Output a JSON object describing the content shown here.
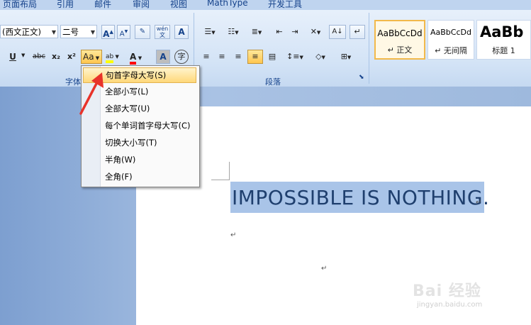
{
  "tabs": [
    "页面布局",
    "引用",
    "邮件",
    "审阅",
    "视图",
    "MathType",
    "开发工具"
  ],
  "font": {
    "family_value": "(西文正文)",
    "size_value": "二号",
    "group_label": "字体",
    "grow_glyph": "A",
    "shrink_glyph": "A",
    "wen_glyph": "wén",
    "underline_glyph": "U",
    "strike_glyph": "abc",
    "subscript_glyph": "x₂",
    "superscript_glyph": "x²",
    "case_glyph": "Aa",
    "highlight_glyph": "ab",
    "color_glyph": "A",
    "shade_glyph": "A",
    "enclose_glyph": "字",
    "highlight_color": "#ffff00",
    "font_color": "#ff0000"
  },
  "paragraph": {
    "group_label": "段落"
  },
  "styles": [
    {
      "sample": "AaBbCcDd",
      "name": "↵ 正文"
    },
    {
      "sample": "AaBbCcDd",
      "name": "↵ 无间隔"
    },
    {
      "sample": "AaBb",
      "name": "标题 1"
    }
  ],
  "menu": {
    "items": [
      "句首字母大写(S)",
      "全部小写(L)",
      "全部大写(U)",
      "每个单词首字母大写(C)",
      "切换大小写(T)",
      "半角(W)",
      "全角(F)"
    ]
  },
  "document": {
    "selected_text": "IMPOSSIBLE IS NOTHING.",
    "paragraph_mark": "↵"
  },
  "watermark": {
    "brand": "Bai 经验",
    "url": "jingyan.baidu.com"
  },
  "colors": {
    "accent_orange": "#ffc64f",
    "selection": "#a9c4e8",
    "arrow": "#e8332a"
  }
}
